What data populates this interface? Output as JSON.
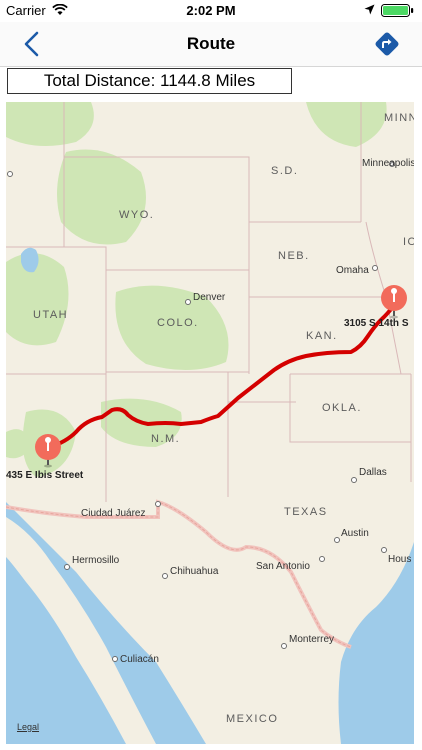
{
  "status_bar": {
    "carrier": "Carrier",
    "time": "2:02 PM"
  },
  "nav": {
    "title": "Route",
    "back_icon": "chevron-left-icon",
    "directions_icon": "directions-diamond-icon"
  },
  "distance_label": "Total Distance: 1144.8 Miles",
  "colors": {
    "accent": "#1c5aa8",
    "route": "#d40000",
    "pin": "#f26b5b",
    "land": "#f3efe3",
    "water": "#9ecbe9",
    "vegetation": "#cfe6b5"
  },
  "map": {
    "states": {
      "sd": "S.D.",
      "wyo": "WYO.",
      "neb": "NEB.",
      "utah": "UTAH",
      "colo": "COLO.",
      "kan": "KAN.",
      "okla": "OKLA.",
      "nm": "N.M.",
      "texas": "TEXAS",
      "minn": "MINN",
      "iowa": "IO"
    },
    "countries": {
      "mexico": "MEXICO"
    },
    "cities": {
      "minneapolis": "Minneapolis",
      "omaha": "Omaha",
      "denver": "Denver",
      "dallas": "Dallas",
      "austin": "Austin",
      "houston": "Hous",
      "ciudad_juarez": "Ciudad Juárez",
      "hermosillo": "Hermosillo",
      "chihuahua": "Chihuahua",
      "san_antonio": "San Antonio",
      "monterrey": "Monterrey",
      "culiacan": "Culiacán"
    },
    "start_label": "435 E Ibis Street",
    "end_label": "3105 S 14th S",
    "legal": "Legal"
  }
}
